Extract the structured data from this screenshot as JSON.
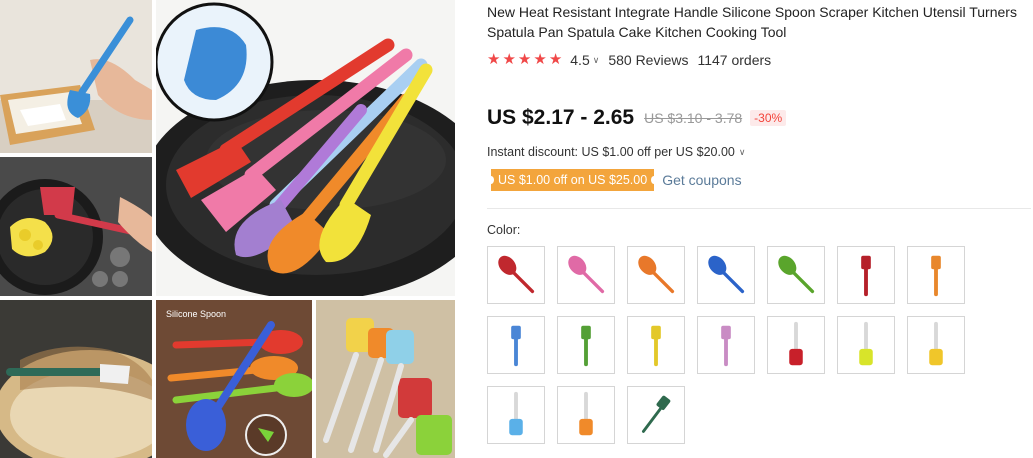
{
  "product": {
    "title": "New Heat Resistant Integrate Handle Silicone Spoon Scraper Kitchen Utensil Turners Spatula Pan Spatula Cake Kitchen Cooking Tool",
    "rating": "4.5",
    "stars_filled": 5,
    "reviews": "580 Reviews",
    "orders": "1147 orders"
  },
  "price": {
    "current": "US $2.17 - 2.65",
    "original": "US $3.10 - 3.78",
    "discount": "-30%"
  },
  "promo": {
    "instant_discount": "Instant discount: US $1.00 off per US $20.00",
    "coupon_label": "US $1.00 off on US $25.00",
    "get_coupons": "Get coupons"
  },
  "gallery": {
    "silicone_spoon_label": "Silicone Spoon"
  },
  "colors": {
    "label": "Color:",
    "options": [
      {
        "kind": "spoon",
        "color": "#c0282e"
      },
      {
        "kind": "spoon",
        "color": "#e06aa6"
      },
      {
        "kind": "spoon",
        "color": "#e8782a"
      },
      {
        "kind": "spoon",
        "color": "#2b63c9"
      },
      {
        "kind": "spoon",
        "color": "#5aa52c"
      },
      {
        "kind": "spatula",
        "color": "#b5202a"
      },
      {
        "kind": "spatula",
        "color": "#e8872c"
      },
      {
        "kind": "spatula",
        "color": "#4a86d6"
      },
      {
        "kind": "spatula",
        "color": "#54a036"
      },
      {
        "kind": "spatula",
        "color": "#e3c82a"
      },
      {
        "kind": "spatula",
        "color": "#c98cc4"
      },
      {
        "kind": "clear",
        "color": "#c8202a"
      },
      {
        "kind": "clear",
        "color": "#d8e42a"
      },
      {
        "kind": "clear",
        "color": "#f0c62a"
      },
      {
        "kind": "clear",
        "color": "#5ab0e8"
      },
      {
        "kind": "clear",
        "color": "#f08a2a"
      },
      {
        "kind": "long",
        "color": "#2f6a4e"
      }
    ]
  }
}
